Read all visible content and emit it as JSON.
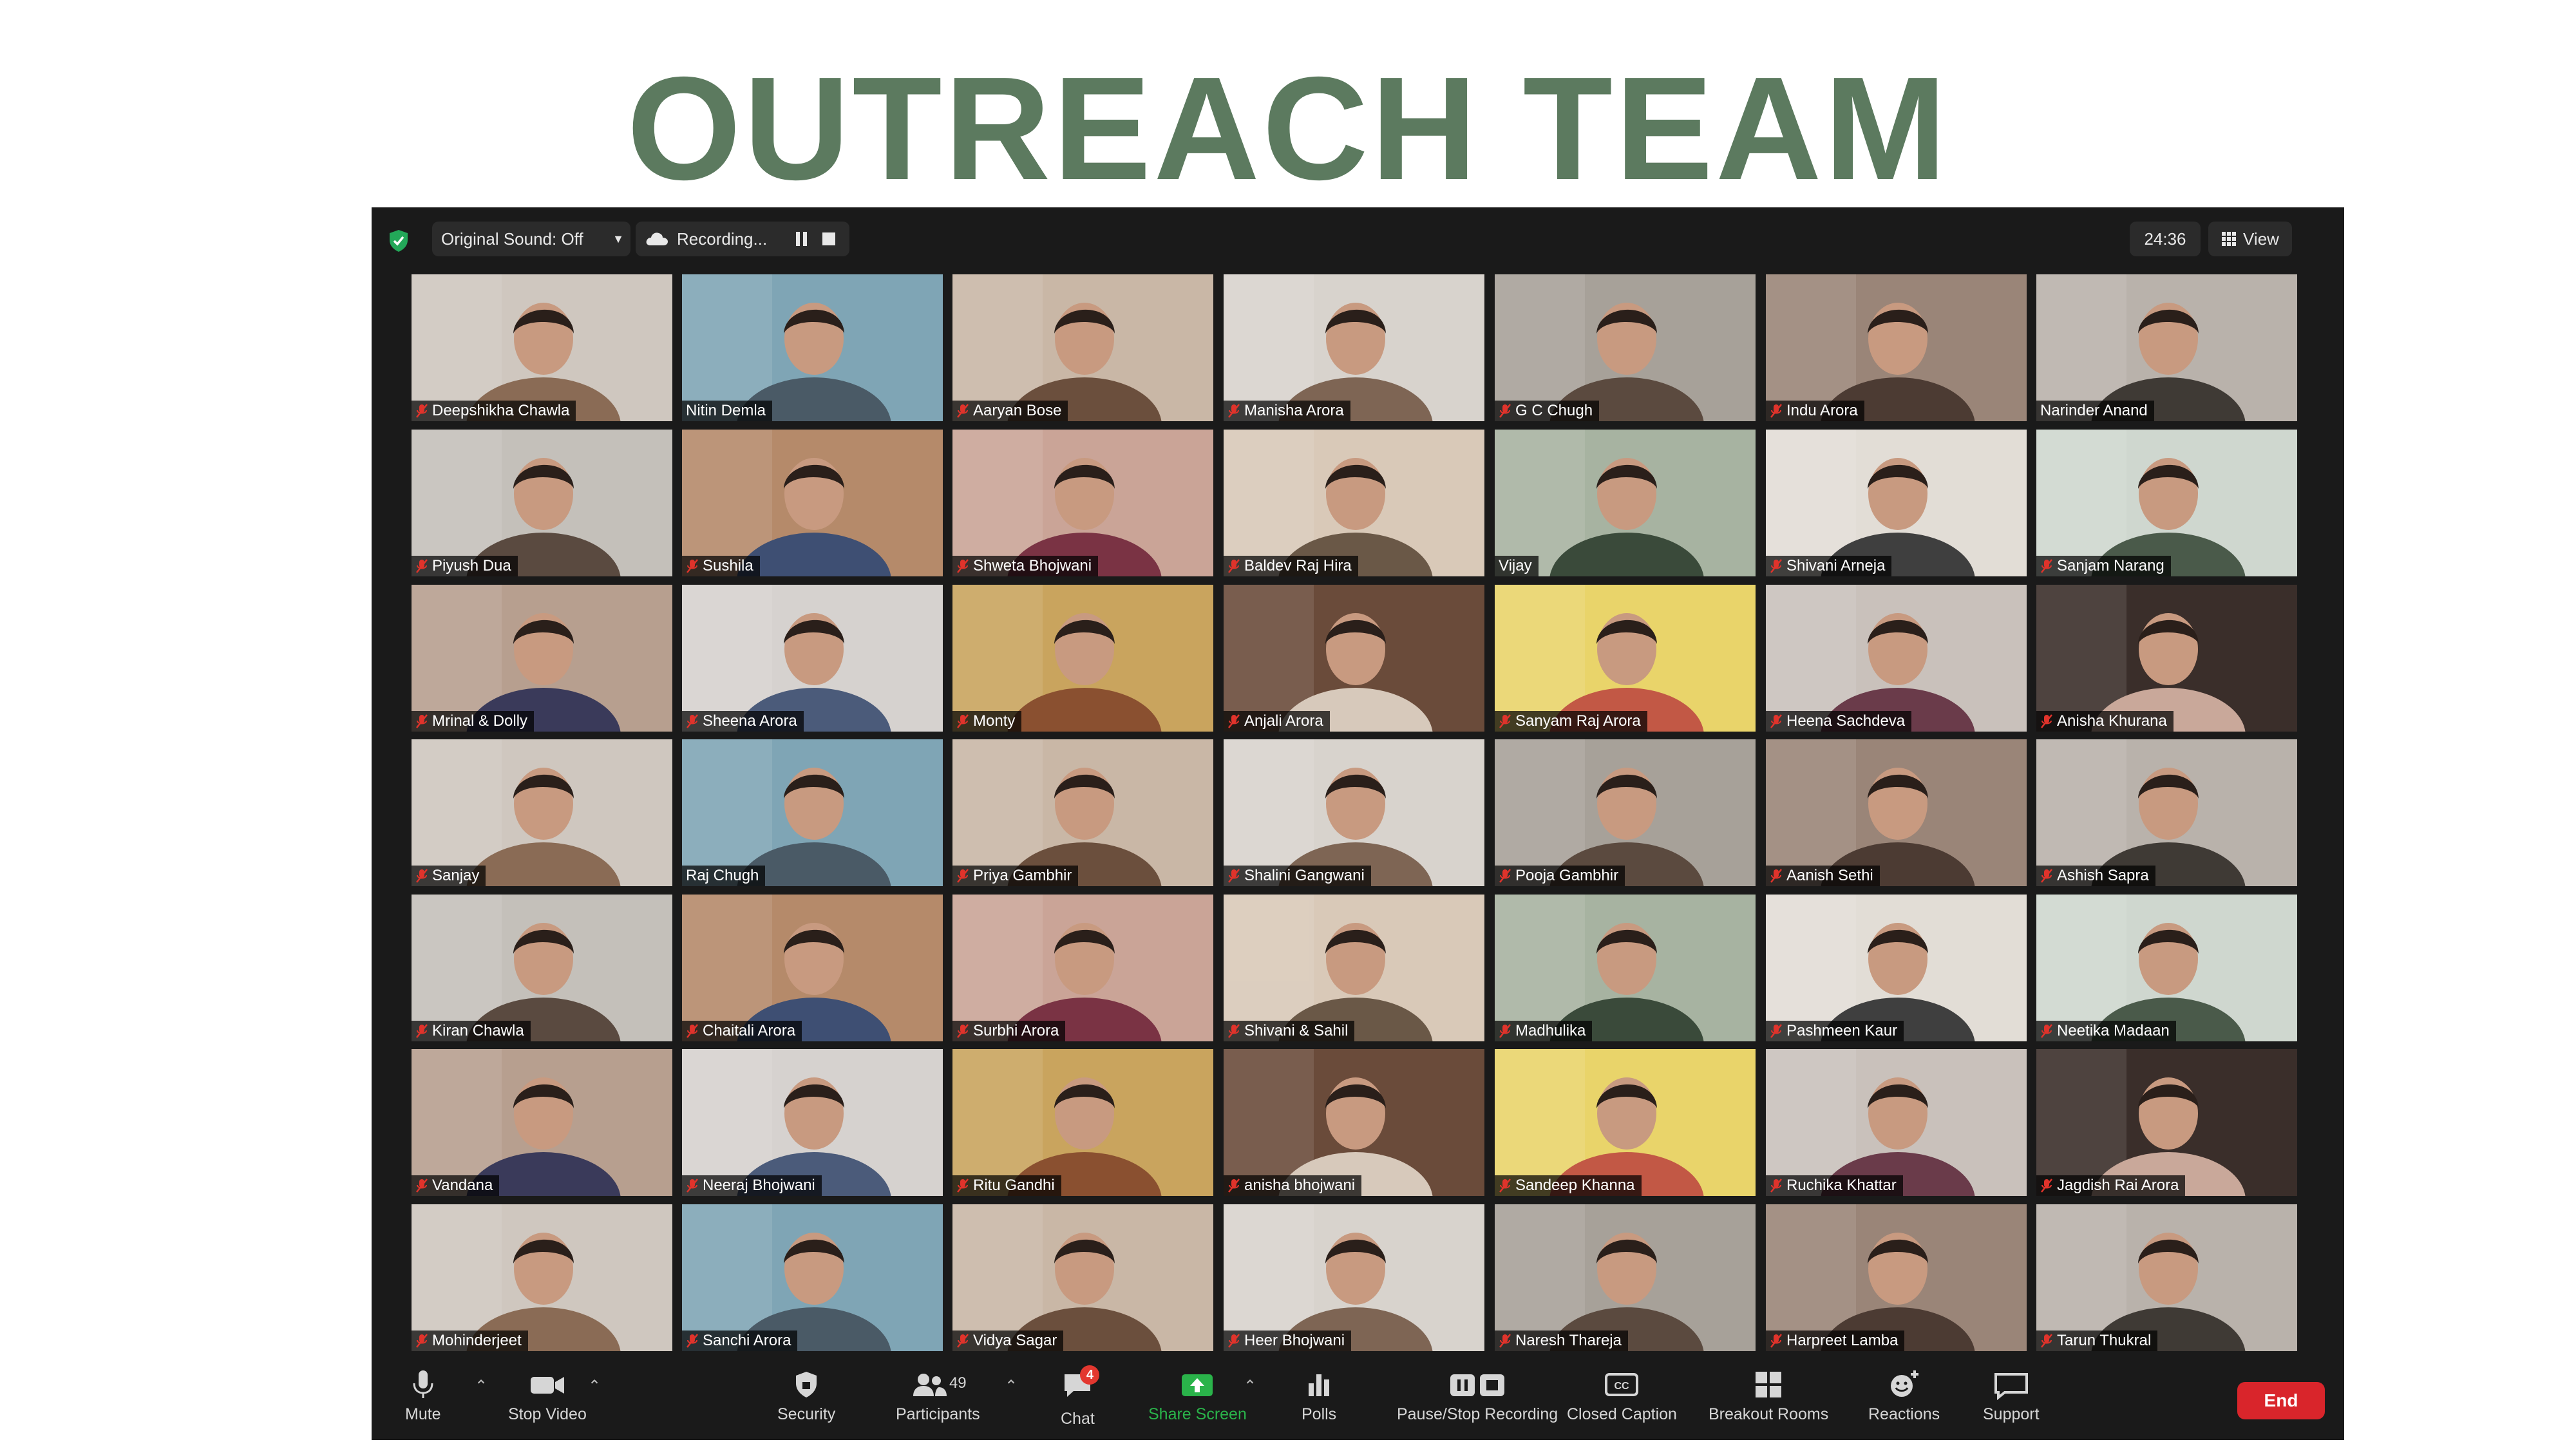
{
  "page_title": "OUTREACH TEAM",
  "meeting": {
    "original_sound": "Original Sound: Off",
    "recording_label": "Recording...",
    "timer": "24:36",
    "view_label": "View",
    "participants_count": "49",
    "chat_badge": "4"
  },
  "toolbar": {
    "mute": "Mute",
    "stop_video": "Stop Video",
    "security": "Security",
    "participants": "Participants",
    "chat": "Chat",
    "share_screen": "Share Screen",
    "polls": "Polls",
    "pause_stop_recording": "Pause/Stop Recording",
    "closed_caption": "Closed Caption",
    "breakout_rooms": "Breakout Rooms",
    "reactions": "Reactions",
    "support": "Support",
    "end": "End"
  },
  "colors": {
    "title_green": "#5c7a5f",
    "active_speaker_border": "#d9e66a",
    "end_red": "#d9252b",
    "share_green": "#2ab34a"
  },
  "participants": [
    {
      "name": "Deepshikha Chawla",
      "muted": true
    },
    {
      "name": "Nitin Demla",
      "muted": false
    },
    {
      "name": "Aaryan Bose",
      "muted": true
    },
    {
      "name": "Manisha Arora",
      "muted": true
    },
    {
      "name": "G C Chugh",
      "muted": true
    },
    {
      "name": "Indu Arora",
      "muted": true
    },
    {
      "name": "Narinder Anand",
      "muted": false
    },
    {
      "name": "Piyush Dua",
      "muted": true
    },
    {
      "name": "Sushila",
      "muted": true
    },
    {
      "name": "Shweta Bhojwani",
      "muted": true
    },
    {
      "name": "Baldev Raj Hira",
      "muted": true
    },
    {
      "name": "Vijay",
      "muted": false,
      "active": true
    },
    {
      "name": "Shivani Arneja",
      "muted": true
    },
    {
      "name": "Sanjam Narang",
      "muted": true
    },
    {
      "name": "Mrinal & Dolly",
      "muted": true
    },
    {
      "name": "Sheena Arora",
      "muted": true
    },
    {
      "name": "Monty",
      "muted": true
    },
    {
      "name": "Anjali Arora",
      "muted": true
    },
    {
      "name": "Sanyam Raj Arora",
      "muted": true
    },
    {
      "name": "Heena Sachdeva",
      "muted": true
    },
    {
      "name": "Anisha Khurana",
      "muted": true
    },
    {
      "name": "Sanjay",
      "muted": true
    },
    {
      "name": "Raj Chugh",
      "muted": false
    },
    {
      "name": "Priya Gambhir",
      "muted": true
    },
    {
      "name": "Shalini Gangwani",
      "muted": true
    },
    {
      "name": "Pooja Gambhir",
      "muted": true
    },
    {
      "name": "Aanish Sethi",
      "muted": true
    },
    {
      "name": "Ashish Sapra",
      "muted": true
    },
    {
      "name": "Kiran Chawla",
      "muted": true
    },
    {
      "name": "Chaitali Arora",
      "muted": true
    },
    {
      "name": "Surbhi Arora",
      "muted": true
    },
    {
      "name": "Shivani & Sahil",
      "muted": true
    },
    {
      "name": "Madhulika",
      "muted": true
    },
    {
      "name": "Pashmeen Kaur",
      "muted": true
    },
    {
      "name": "Neetika Madaan",
      "muted": true
    },
    {
      "name": "Vandana",
      "muted": true
    },
    {
      "name": "Neeraj Bhojwani",
      "muted": true
    },
    {
      "name": "Ritu Gandhi",
      "muted": true
    },
    {
      "name": "anisha bhojwani",
      "muted": true
    },
    {
      "name": "Sandeep Khanna",
      "muted": true
    },
    {
      "name": "Ruchika Khattar",
      "muted": true
    },
    {
      "name": "Jagdish Rai Arora",
      "muted": true
    },
    {
      "name": "Mohinderjeet",
      "muted": true
    },
    {
      "name": "Sanchi Arora",
      "muted": true
    },
    {
      "name": "Vidya Sagar",
      "muted": true
    },
    {
      "name": "Heer Bhojwani",
      "muted": true
    },
    {
      "name": "Naresh Thareja",
      "muted": true
    },
    {
      "name": "Harpreet Lamba",
      "muted": true
    },
    {
      "name": "Tarun Thukral",
      "muted": true
    }
  ]
}
